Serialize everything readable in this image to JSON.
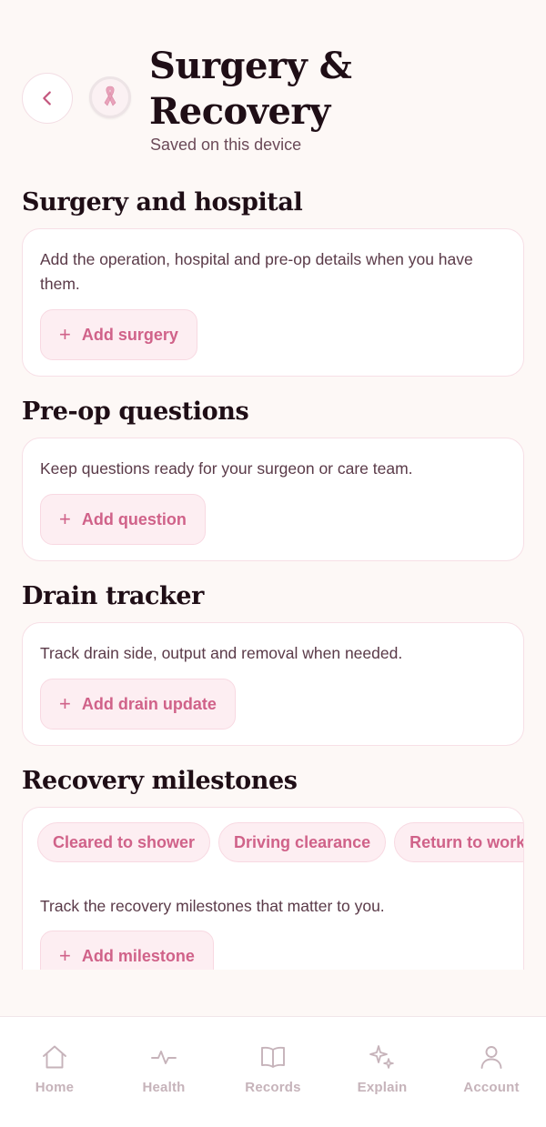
{
  "header": {
    "title": "Surgery & Recovery",
    "subtitle": "Saved on this device",
    "back_icon": "chevron-left-icon",
    "badge_icon": "awareness-ribbon-icon"
  },
  "sections": {
    "surgery": {
      "title": "Surgery and hospital",
      "description": "Add the operation, hospital and pre-op details when you have them.",
      "button_label": "Add surgery"
    },
    "preop": {
      "title": "Pre-op questions",
      "description": "Keep questions ready for your surgeon or care team.",
      "button_label": "Add question"
    },
    "drain": {
      "title": "Drain tracker",
      "description": "Track drain side, output and removal when needed.",
      "button_label": "Add drain update"
    },
    "milestones": {
      "title": "Recovery milestones",
      "chips": [
        "Cleared to shower",
        "Driving clearance",
        "Return to work"
      ],
      "description": "Track the recovery milestones that matter to you.",
      "button_label": "Add milestone"
    }
  },
  "bottom_nav": {
    "items": [
      {
        "label": "Home",
        "icon": "home-icon"
      },
      {
        "label": "Health",
        "icon": "pulse-icon"
      },
      {
        "label": "Records",
        "icon": "book-icon"
      },
      {
        "label": "Explain",
        "icon": "sparkle-icon"
      },
      {
        "label": "Account",
        "icon": "person-icon"
      }
    ]
  },
  "colors": {
    "background": "#fdf8f6",
    "accent": "#d06289",
    "chip_bg": "#fdeef2",
    "heading": "#1f0e16",
    "nav_inactive": "#c6b3ba"
  }
}
